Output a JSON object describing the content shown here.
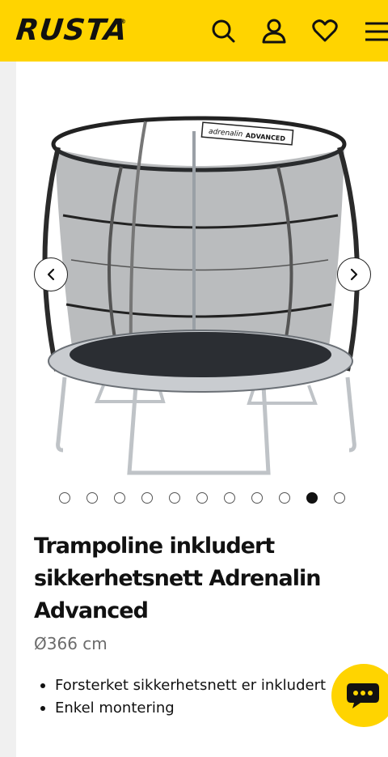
{
  "header": {
    "logo_text": "RUSTA",
    "logo_mark": "®",
    "icons": [
      "search-icon",
      "user-icon",
      "heart-icon",
      "menu-icon"
    ]
  },
  "gallery": {
    "image_alt": "Trampoline inkludert sikkerhetsnett Adrenalin Advanced",
    "brand_on_net": "adrenalin",
    "model_on_net": "ADVANCED",
    "slide_count": 11,
    "active_slide_index": 9
  },
  "product": {
    "title": "Trampoline inkludert sikkerhetsnett Adrenalin Advanced",
    "size": "Ø366 cm",
    "bullets": [
      "Forsterket sikkerhetsnett er inkludert",
      "Enkel montering"
    ]
  },
  "colors": {
    "brand_yellow": "#ffd400",
    "text_dark": "#111111",
    "text_muted": "#6b6b6b"
  }
}
